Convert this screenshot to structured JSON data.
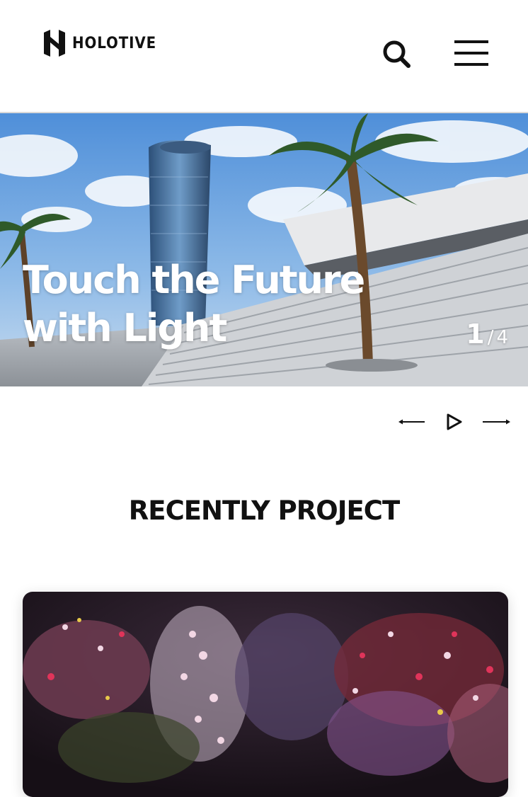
{
  "header": {
    "logo_text": "HOLOTIVE",
    "search_icon": "search-icon",
    "menu_icon": "hamburger-menu-icon"
  },
  "hero": {
    "title_line1": "Touch the Future",
    "title_line2": "with Light",
    "slide_current": "1",
    "slide_separator": "/",
    "slide_total": "4"
  },
  "slider_controls": {
    "prev_icon": "arrow-left-icon",
    "play_icon": "play-icon",
    "next_icon": "arrow-right-icon"
  },
  "section": {
    "title": "RECENTLY PROJECT"
  },
  "colors": {
    "text": "#111111",
    "hero_text": "#ffffff",
    "header_border": "#d9d9d9"
  }
}
